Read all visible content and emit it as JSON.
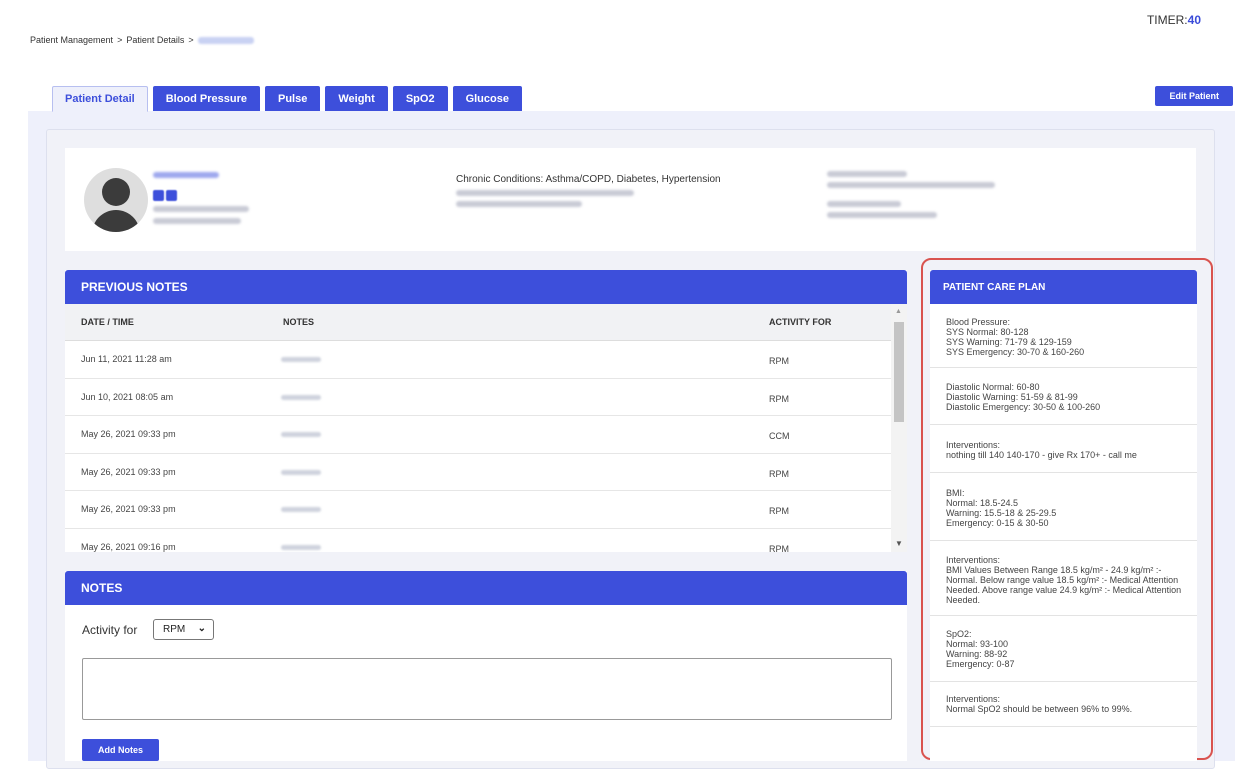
{
  "breadcrumb": {
    "item1": "Patient Management",
    "sep1": ">",
    "item2": "Patient Details",
    "sep2": ">"
  },
  "timer": {
    "label": "TIMER:",
    "value": "40"
  },
  "tabs": [
    {
      "label": "Patient Detail",
      "active": true
    },
    {
      "label": "Blood Pressure"
    },
    {
      "label": "Pulse"
    },
    {
      "label": "Weight"
    },
    {
      "label": "SpO2"
    },
    {
      "label": "Glucose"
    }
  ],
  "edit_patient_label": "Edit Patient",
  "profile": {
    "chronic_conditions": "Chronic Conditions: Asthma/COPD, Diabetes, Hypertension"
  },
  "previous_notes": {
    "title": "PREVIOUS NOTES",
    "columns": {
      "date": "DATE / TIME",
      "notes": "NOTES",
      "activity": "ACTIVITY FOR"
    },
    "rows": [
      {
        "date": "Jun 11, 2021 11:28 am",
        "activity": "RPM"
      },
      {
        "date": "Jun 10, 2021 08:05 am",
        "activity": "RPM"
      },
      {
        "date": "May 26, 2021 09:33 pm",
        "activity": "CCM"
      },
      {
        "date": "May 26, 2021 09:33 pm",
        "activity": "RPM"
      },
      {
        "date": "May 26, 2021 09:33 pm",
        "activity": "RPM"
      },
      {
        "date": "May 26, 2021 09:16 pm",
        "activity": "RPM"
      }
    ]
  },
  "notes_form": {
    "title": "NOTES",
    "activity_label": "Activity for",
    "activity_value": "RPM",
    "add_button": "Add Notes"
  },
  "care_plan": {
    "title": "PATIENT CARE PLAN",
    "blocks": [
      "Blood Pressure:\nSYS Normal: 80-128\nSYS Warning: 71-79 & 129-159\nSYS Emergency: 30-70 & 160-260",
      "Diastolic Normal: 60-80\nDiastolic Warning: 51-59 & 81-99\nDiastolic Emergency: 30-50 & 100-260",
      "Interventions:\nnothing till 140 140-170 - give Rx 170+ - call me",
      "BMI:\nNormal: 18.5-24.5\nWarning: 15.5-18 & 25-29.5\nEmergency: 0-15 & 30-50",
      "Interventions:\nBMI Values Between Range 18.5 kg/m² - 24.9 kg/m² :- Normal. Below range value 18.5 kg/m² :- Medical Attention Needed. Above range value 24.9 kg/m² :- Medical Attention Needed.",
      "SpO2:\nNormal: 93-100\nWarning: 88-92\nEmergency: 0-87",
      "Interventions:\nNormal SpO2 should be between 96% to 99%."
    ]
  }
}
